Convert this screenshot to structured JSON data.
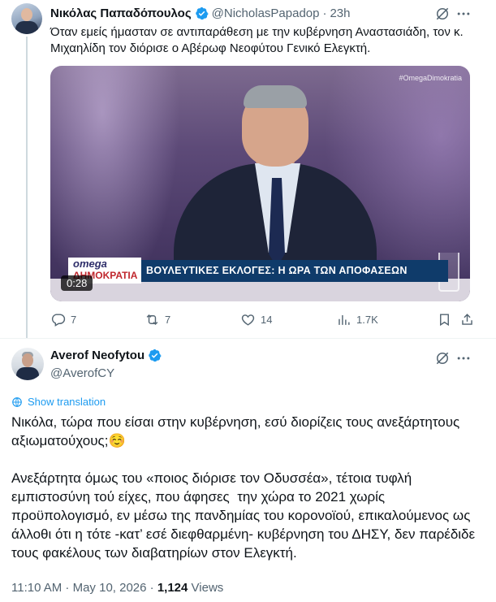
{
  "parent_tweet": {
    "author_name": "Νικόλας Παπαδόπουλος",
    "handle": "@NicholasPapadop",
    "separator": "·",
    "time": "23h",
    "text": "Όταν εμείς ήμασταν σε αντιπαράθεση με την κυβέρνηση Αναστασιάδη, τον κ. Μιχαηλίδη τον διόρισε ο Αβέρωφ Νεοφύτου Γενικό Ελεγκτή.",
    "video": {
      "hashtag": "#OmegaDimokratia",
      "logo_top": "omega",
      "logo_bottom": "ΔΗΜΟΚΡΑΤΙΑ",
      "banner": "ΒΟΥΛΕΥΤΙΚΕΣ ΕΚΛΟΓΕΣ: Η ΩΡΑ ΤΩΝ ΑΠΟΦΑΣΕΩΝ",
      "duration": "0:28"
    },
    "actions": {
      "replies": "7",
      "reposts": "7",
      "likes": "14",
      "views": "1.7K"
    }
  },
  "main_tweet": {
    "author_name": "Averof Neofytou",
    "handle": "@AverofCY",
    "show_translation": "Show translation",
    "paragraph1": "Νικόλα, τώρα που είσαι στην κυβέρνηση, εσύ διορίζεις τους ανεξάρτητους αξιωματούχους;☺️",
    "paragraph2": "Ανεξάρτητα όμως του «ποιος διόρισε τον Οδυσσέα», τέτοια τυφλή εμπιστοσύνη τού είχες, που άφησες  την χώρα το 2021 χωρίς προϋπολογισμό, εν μέσω της πανδημίας του κορονοϊού, επικαλούμενος ως άλλοθι ότι η τότε -κατ’ εσέ διεφθαρμένη- κυβέρνηση του ΔΗΣΥ, δεν παρέδιδε τους φακέλους των διαβατηρίων στον Ελεγκτή.",
    "timestamp": "11:10 AM · May 10, 2026 · ",
    "views_count": "1,124",
    "views_label": " Views"
  },
  "colors": {
    "accent": "#1d9bf0",
    "muted_text": "#536471",
    "text": "#0f1419",
    "divider": "#eff3f4"
  },
  "icons": [
    "verified-badge-icon",
    "grok-icon",
    "more-icon",
    "reply-icon",
    "repost-icon",
    "like-icon",
    "views-icon",
    "translate-icon"
  ]
}
